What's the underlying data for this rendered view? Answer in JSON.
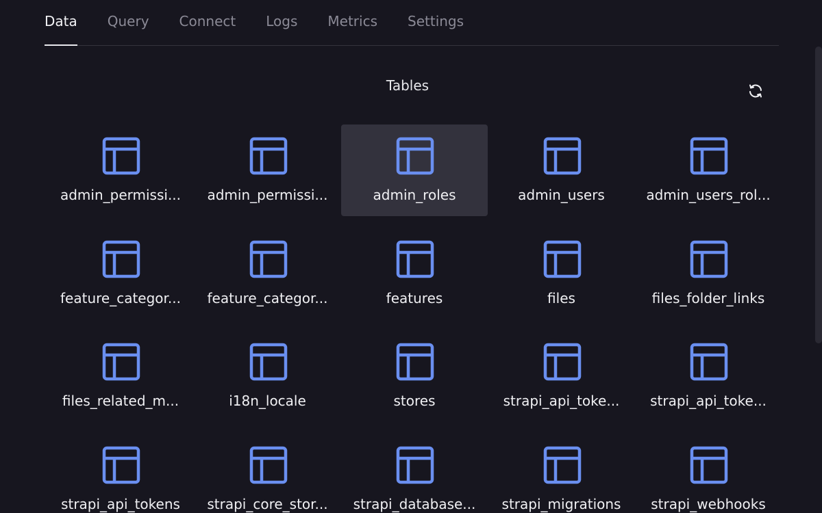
{
  "tabs": [
    {
      "label": "Data",
      "active": true
    },
    {
      "label": "Query",
      "active": false
    },
    {
      "label": "Connect",
      "active": false
    },
    {
      "label": "Logs",
      "active": false
    },
    {
      "label": "Metrics",
      "active": false
    },
    {
      "label": "Settings",
      "active": false
    }
  ],
  "section": {
    "title": "Tables",
    "refresh_icon": "refresh-icon"
  },
  "colors": {
    "background": "#17161f",
    "table_icon": "#6a8ff0",
    "selected_tile": "#33323d"
  },
  "tables": [
    {
      "label": "admin_permissi...",
      "selected": false
    },
    {
      "label": "admin_permissi...",
      "selected": false
    },
    {
      "label": "admin_roles",
      "selected": true
    },
    {
      "label": "admin_users",
      "selected": false
    },
    {
      "label": "admin_users_rol...",
      "selected": false
    },
    {
      "label": "feature_categor...",
      "selected": false
    },
    {
      "label": "feature_categor...",
      "selected": false
    },
    {
      "label": "features",
      "selected": false
    },
    {
      "label": "files",
      "selected": false
    },
    {
      "label": "files_folder_links",
      "selected": false
    },
    {
      "label": "files_related_m...",
      "selected": false
    },
    {
      "label": "i18n_locale",
      "selected": false
    },
    {
      "label": "stores",
      "selected": false
    },
    {
      "label": "strapi_api_toke...",
      "selected": false
    },
    {
      "label": "strapi_api_toke...",
      "selected": false
    },
    {
      "label": "strapi_api_tokens",
      "selected": false
    },
    {
      "label": "strapi_core_stor...",
      "selected": false
    },
    {
      "label": "strapi_database...",
      "selected": false
    },
    {
      "label": "strapi_migrations",
      "selected": false
    },
    {
      "label": "strapi_webhooks",
      "selected": false
    }
  ]
}
